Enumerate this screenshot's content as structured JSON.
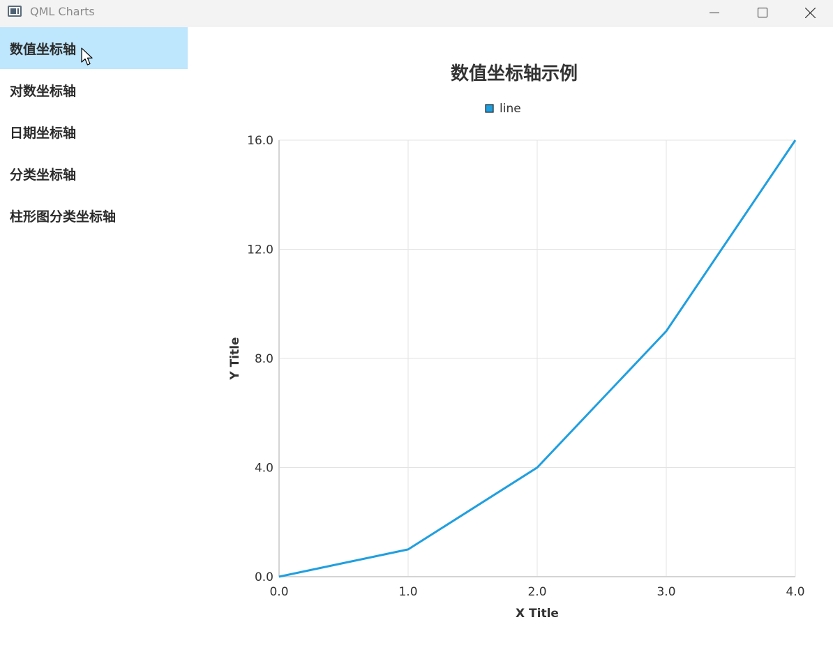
{
  "window": {
    "title": "QML Charts",
    "controls": {
      "minimize": "minimize-icon",
      "maximize": "maximize-icon",
      "close": "close-icon"
    }
  },
  "sidebar": {
    "items": [
      {
        "label": "数值坐标轴",
        "active": true
      },
      {
        "label": "对数坐标轴",
        "active": false
      },
      {
        "label": "日期坐标轴",
        "active": false
      },
      {
        "label": "分类坐标轴",
        "active": false
      },
      {
        "label": "柱形图分类坐标轴",
        "active": false
      }
    ],
    "active_color": "#bee6fd"
  },
  "chart_data": {
    "type": "line",
    "title": "数值坐标轴示例",
    "xlabel": "X Title",
    "ylabel": "Y Title",
    "xlim": [
      0,
      4
    ],
    "ylim": [
      0,
      16
    ],
    "x_ticks": [
      "0.0",
      "1.0",
      "2.0",
      "3.0",
      "4.0"
    ],
    "y_ticks": [
      "0.0",
      "4.0",
      "8.0",
      "12.0",
      "16.0"
    ],
    "grid": true,
    "legend": "top-center",
    "series": [
      {
        "name": "line",
        "color": "#209fdf",
        "x": [
          0,
          1,
          2,
          3,
          4
        ],
        "y": [
          0,
          1,
          4,
          9,
          16
        ]
      }
    ]
  }
}
